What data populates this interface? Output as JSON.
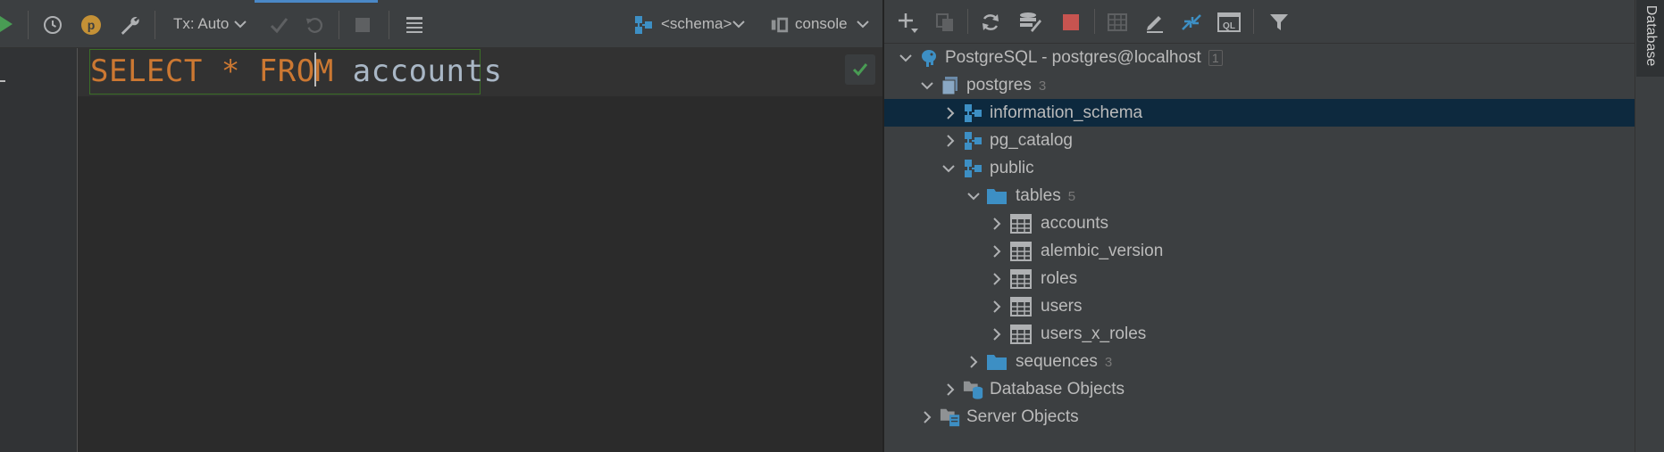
{
  "editor": {
    "toolbar": {
      "tx_mode": "Tx: Auto",
      "schema_selector": "<schema>",
      "console_selector": "console"
    },
    "query": {
      "kw1": "SELECT",
      "star": "*",
      "kw2_a": "FRO",
      "kw2_b": "M",
      "table": "accounts"
    }
  },
  "db_panel": {
    "title": "Database",
    "tree": [
      {
        "label": "PostgreSQL - postgres@localhost",
        "count": "1"
      },
      {
        "label": "postgres",
        "count": "3"
      },
      {
        "label": "information_schema"
      },
      {
        "label": "pg_catalog"
      },
      {
        "label": "public"
      },
      {
        "label": "tables",
        "count": "5"
      },
      {
        "label": "accounts"
      },
      {
        "label": "alembic_version"
      },
      {
        "label": "roles"
      },
      {
        "label": "users"
      },
      {
        "label": "users_x_roles"
      },
      {
        "label": "sequences",
        "count": "3"
      },
      {
        "label": "Database Objects"
      },
      {
        "label": "Server Objects"
      }
    ]
  },
  "colors": {
    "keyword": "#cc7832",
    "identifier": "#a9b7c6",
    "selection": "#0d293e",
    "accent_blue": "#3d8fc4",
    "run_green": "#499c54",
    "stop_red": "#c75450"
  }
}
